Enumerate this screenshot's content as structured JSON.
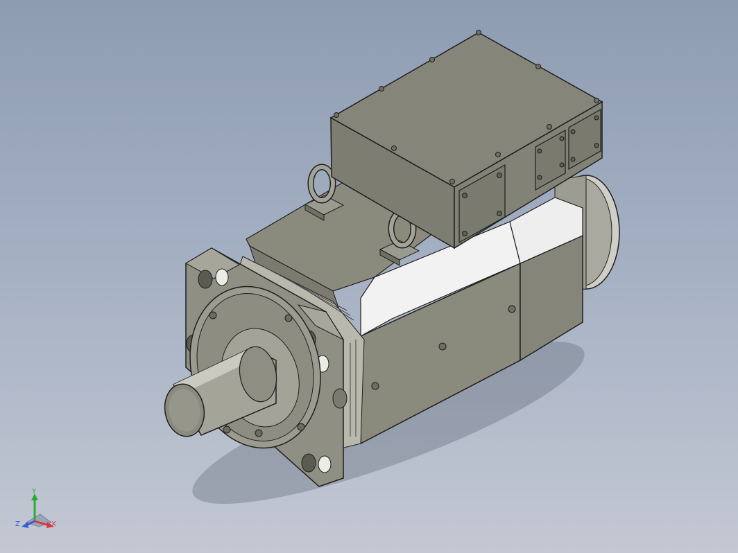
{
  "viewport": {
    "background_top": "#8e9cb2",
    "background_bottom": "#c3c8d3"
  },
  "model": {
    "body_color": "#8a8a7d",
    "highlight_color": "#f2f2f2",
    "edge_color": "#1e1e1e"
  },
  "triad": {
    "x_label": "X",
    "y_label": "Y",
    "z_label": "Z",
    "x_color": "#d23c3c",
    "y_color": "#2fa83a",
    "z_color": "#3a5bd8"
  }
}
